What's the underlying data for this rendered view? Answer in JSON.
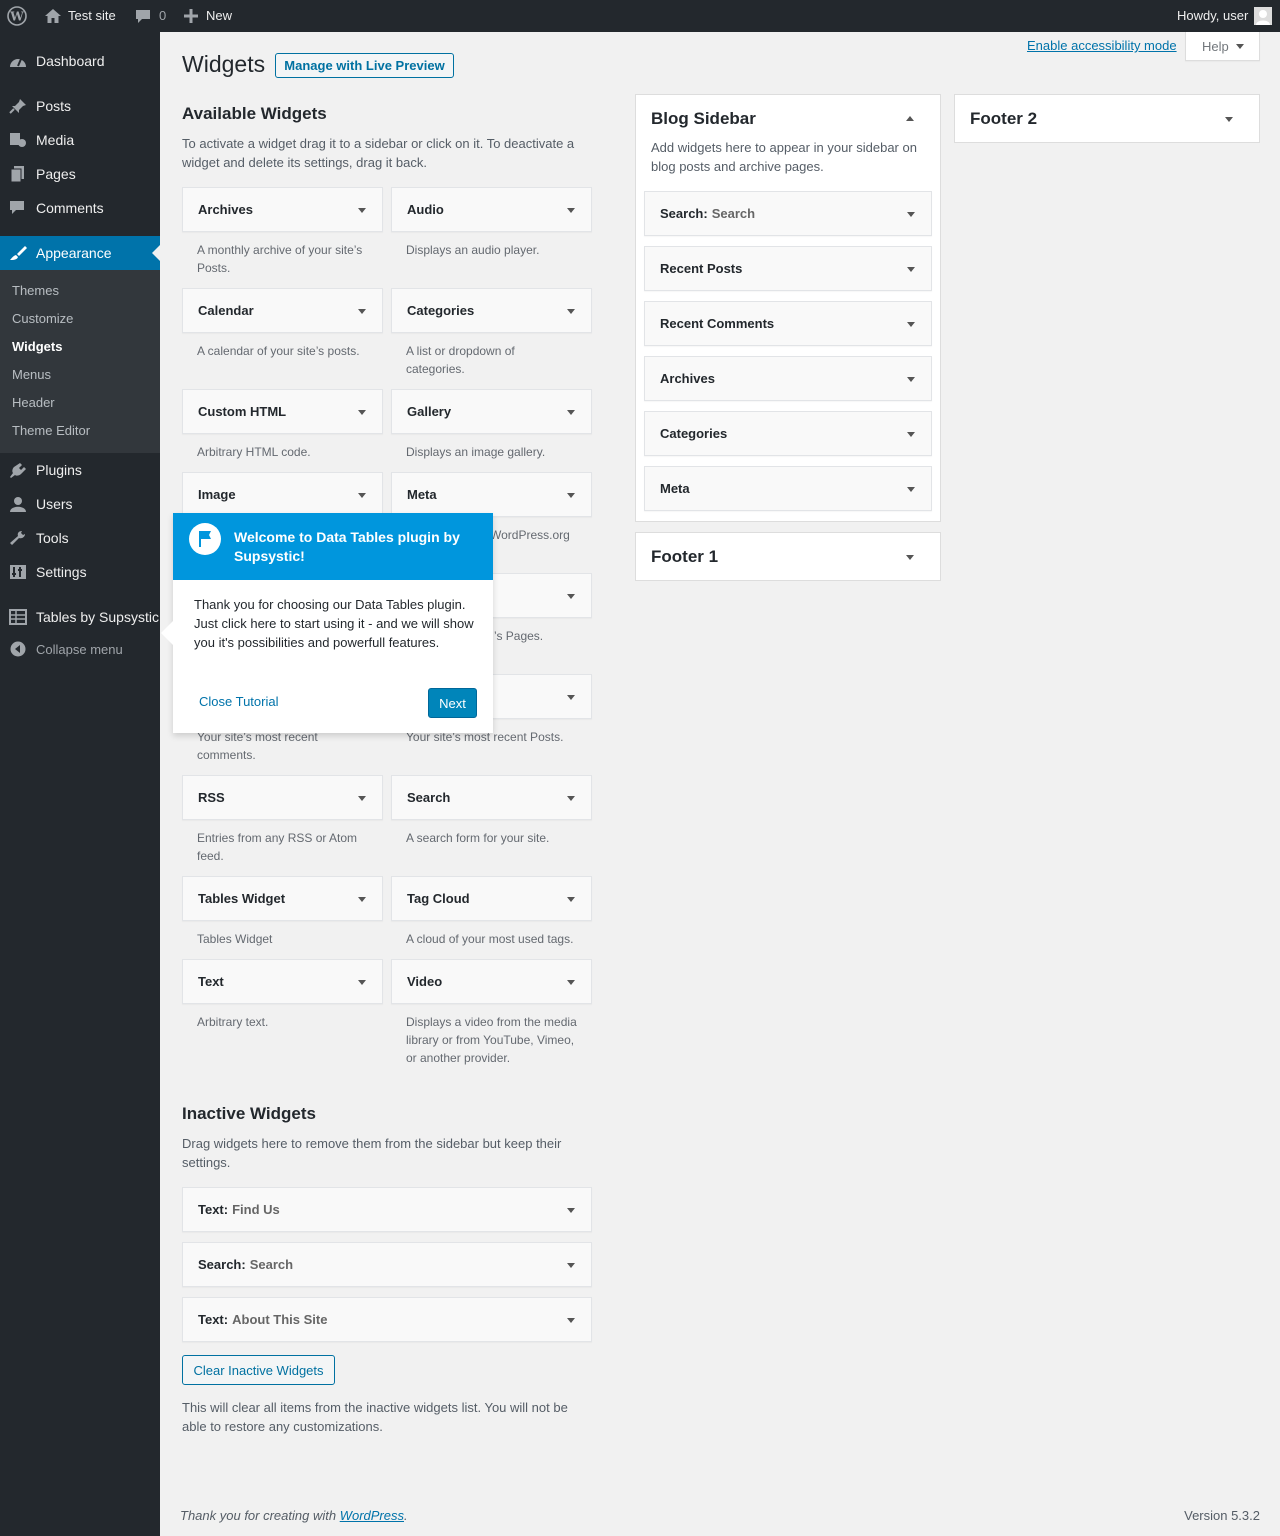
{
  "adminbar": {
    "site_name": "Test site",
    "comments_count": "0",
    "new_label": "New",
    "howdy": "Howdy, user"
  },
  "menu": {
    "dashboard": "Dashboard",
    "posts": "Posts",
    "media": "Media",
    "pages": "Pages",
    "comments": "Comments",
    "appearance": "Appearance",
    "submenu": [
      "Themes",
      "Customize",
      "Widgets",
      "Menus",
      "Header",
      "Theme Editor"
    ],
    "plugins": "Plugins",
    "users": "Users",
    "tools": "Tools",
    "settings": "Settings",
    "tables": "Tables by Supsystic",
    "collapse": "Collapse menu"
  },
  "header": {
    "title": "Widgets",
    "live_preview": "Manage with Live Preview",
    "accessibility": "Enable accessibility mode",
    "help": "Help"
  },
  "available": {
    "heading": "Available Widgets",
    "description": "To activate a widget drag it to a sidebar or click on it. To deactivate a widget and delete its settings, drag it back.",
    "widgets": [
      {
        "title": "Archives",
        "desc": "A monthly archive of your site’s Posts."
      },
      {
        "title": "Audio",
        "desc": "Displays an audio player."
      },
      {
        "title": "Calendar",
        "desc": "A calendar of your site’s posts."
      },
      {
        "title": "Categories",
        "desc": "A list or dropdown of categories."
      },
      {
        "title": "Custom HTML",
        "desc": "Arbitrary HTML code."
      },
      {
        "title": "Gallery",
        "desc": "Displays an image gallery."
      },
      {
        "title": "Image",
        "desc": ""
      },
      {
        "title": "Meta",
        "desc": "WordPress.org"
      },
      {
        "title": "",
        "desc": ""
      },
      {
        "title": "",
        "desc": "’s Pages."
      },
      {
        "title": "",
        "desc": "Your site’s most recent comments."
      },
      {
        "title": "",
        "desc": "Your site’s most recent Posts."
      },
      {
        "title": "RSS",
        "desc": "Entries from any RSS or Atom feed."
      },
      {
        "title": "Search",
        "desc": "A search form for your site."
      },
      {
        "title": "Tables Widget",
        "desc": "Tables Widget"
      },
      {
        "title": "Tag Cloud",
        "desc": "A cloud of your most used tags."
      },
      {
        "title": "Text",
        "desc": "Arbitrary text."
      },
      {
        "title": "Video",
        "desc": "Displays a video from the media library or from YouTube, Vimeo, or another provider."
      }
    ]
  },
  "inactive": {
    "heading": "Inactive Widgets",
    "description": "Drag widgets here to remove them from the sidebar but keep their settings.",
    "widgets": [
      {
        "title": "Text:",
        "sub": "Find Us"
      },
      {
        "title": "Search:",
        "sub": "Search"
      },
      {
        "title": "Text:",
        "sub": "About This Site"
      }
    ],
    "clear_button": "Clear Inactive Widgets",
    "clear_note": "This will clear all items from the inactive widgets list. You will not be able to restore any customizations."
  },
  "blog_sidebar": {
    "title": "Blog Sidebar",
    "description": "Add widgets here to appear in your sidebar on blog posts and archive pages.",
    "widgets": [
      {
        "title": "Search:",
        "sub": "Search"
      },
      {
        "title": "Recent Posts",
        "sub": ""
      },
      {
        "title": "Recent Comments",
        "sub": ""
      },
      {
        "title": "Archives",
        "sub": ""
      },
      {
        "title": "Categories",
        "sub": ""
      },
      {
        "title": "Meta",
        "sub": ""
      }
    ]
  },
  "footer1": {
    "title": "Footer 1"
  },
  "footer2": {
    "title": "Footer 2"
  },
  "tour": {
    "title": "Welcome to Data Tables plugin by Supsystic!",
    "body": "Thank you for choosing our Data Tables plugin. Just click here to start using it - and we will show you it's possibilities and powerfull features.",
    "close": "Close Tutorial",
    "next": "Next"
  },
  "footer": {
    "thanks_prefix": "Thank you for creating with",
    "wordpress": "WordPress",
    "version": "Version 5.3.2"
  },
  "colors": {
    "accent": "#0073aa",
    "menu_bg": "#23282d",
    "tour": "#0096dd"
  }
}
